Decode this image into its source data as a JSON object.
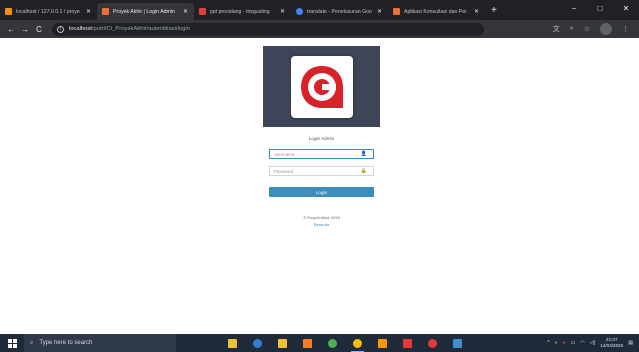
{
  "browser": {
    "tabs": [
      {
        "title": "localhost / 127.0.0.1 / proye",
        "favicon_color": "#f29111",
        "active": false
      },
      {
        "title": "Proyek Akhir | Login Admin",
        "favicon_color": "#e9713a",
        "active": true
      },
      {
        "title": "ppt prosidang - trisgusting",
        "favicon_color": "#d9423a",
        "active": false
      },
      {
        "title": "translate - Penelusuran Goo",
        "favicon_color": "#4285f4",
        "active": false
      },
      {
        "title": "Aplikasi Konsultasi dan Per",
        "favicon_color": "#e9713a",
        "active": false
      }
    ],
    "new_tab_label": "+",
    "window_controls": {
      "minimize": "−",
      "maximize": "□",
      "close": "✕"
    },
    "nav": {
      "back": "←",
      "forward": "→",
      "reload": "C"
    },
    "address": {
      "host": "localhost",
      "path": "/putri/CI_ProyekAkhir/autentikasi/login"
    }
  },
  "login": {
    "heading": "Login Admin",
    "username_placeholder": "Username",
    "password_placeholder": "Password",
    "button_label": "Login",
    "footer_copyright": "© Proyek Akhir 2019",
    "footer_link": "Beranda"
  },
  "taskbar": {
    "search_placeholder": "Type here to search",
    "time": "21:07",
    "date": "14/04/2020",
    "pinned_apps": [
      {
        "icon": "file-explorer-icon",
        "color": "#f3c033"
      },
      {
        "icon": "edge-icon",
        "color": "#2f80d1"
      },
      {
        "icon": "store-icon",
        "color": "#f3c033"
      },
      {
        "icon": "xampp-icon",
        "color": "#fb7a24"
      },
      {
        "icon": "app-icon",
        "color": "#4caf50"
      },
      {
        "icon": "chrome-icon",
        "color": "#fbbc05"
      },
      {
        "icon": "sublime-icon",
        "color": "#ff9800"
      },
      {
        "icon": "app-grid-icon",
        "color": "#e53935"
      },
      {
        "icon": "pdf-icon",
        "color": "#e53935"
      },
      {
        "icon": "photos-icon",
        "color": "#3e8ed0"
      }
    ]
  },
  "colors": {
    "logo_red": "#d8222a",
    "login_button": "#3c8dbc",
    "logo_bg": "#3e4558"
  }
}
